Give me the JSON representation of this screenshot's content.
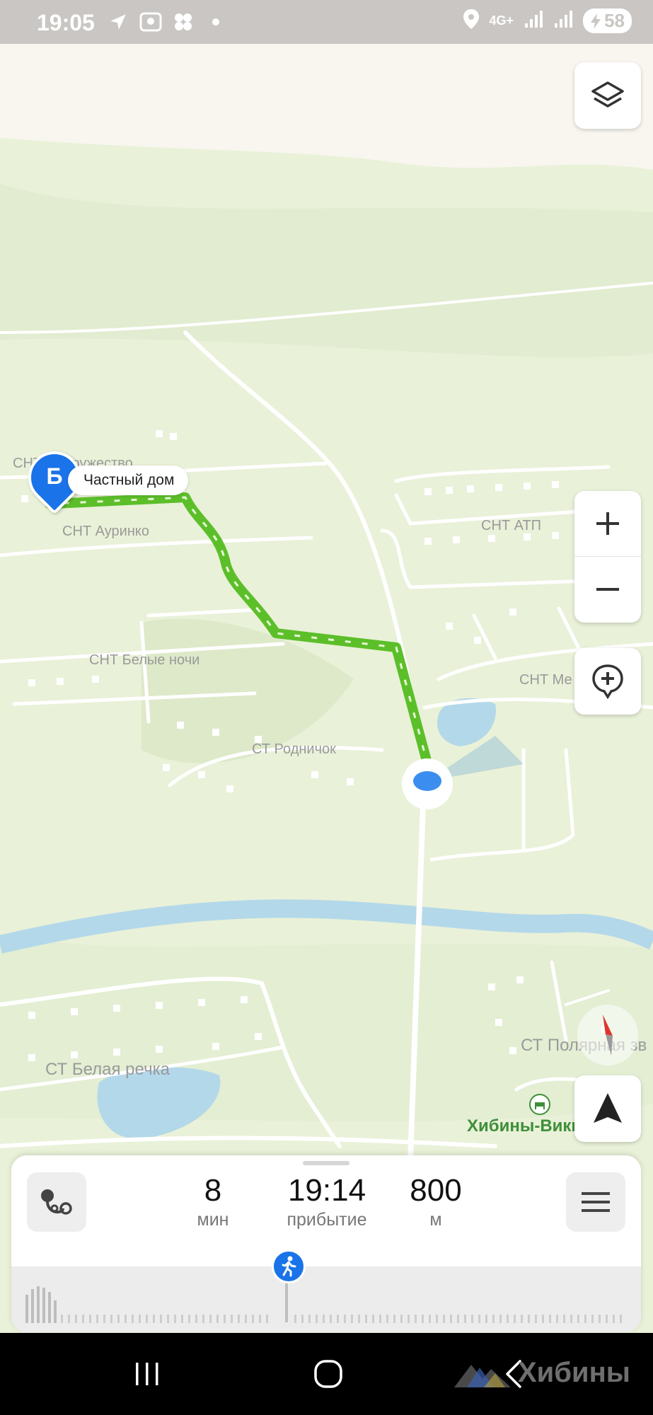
{
  "status_bar": {
    "time": "19:05",
    "network": "4G+",
    "battery": "58",
    "icons": [
      "location-arrow-icon",
      "gallery-icon",
      "app-dots-icon",
      "dot-icon",
      "location-pin-icon",
      "signal-icon",
      "signal-icon",
      "charging-icon"
    ]
  },
  "map": {
    "destination": {
      "letter": "Б",
      "label": "Частный дом"
    },
    "labels": {
      "snt_sodruzhestvo": "СНТ Содружество",
      "snt_aurinko": "СНТ Ауринко",
      "snt_atp": "СНТ АТП",
      "snt_belye_nochi": "СНТ Белые ночи",
      "snt_me": "СНТ Ме",
      "st_rodnichok": "СТ Родничок",
      "st_polyarnaya": "СТ Полярная зв",
      "st_belaya_rechka": "СТ Белая речка",
      "poi_khibiny": "Хибины-Викинг"
    },
    "colors": {
      "route": "#5cbf2a",
      "water": "#b3d8ea",
      "land": "#e9f1d8",
      "accent": "#1a73e8"
    }
  },
  "controls": {
    "layers_icon": "layers-icon",
    "zoom_in_icon": "plus-icon",
    "zoom_out_icon": "minus-icon",
    "add_place_icon": "add-place-icon",
    "compass_icon": "compass-icon",
    "navigate_icon": "navigation-arrow-icon"
  },
  "route_panel": {
    "duration_value": "8",
    "duration_unit": "мин",
    "arrival_value": "19:14",
    "arrival_unit": "прибытие",
    "distance_value": "800",
    "distance_unit": "м",
    "route_options_icon": "route-options-icon",
    "menu_icon": "menu-icon",
    "walker_icon": "pedestrian-icon"
  },
  "nav_bar": {
    "buttons": [
      "recents-icon",
      "home-icon",
      "back-icon"
    ]
  },
  "watermark": {
    "text": "Хибины"
  }
}
